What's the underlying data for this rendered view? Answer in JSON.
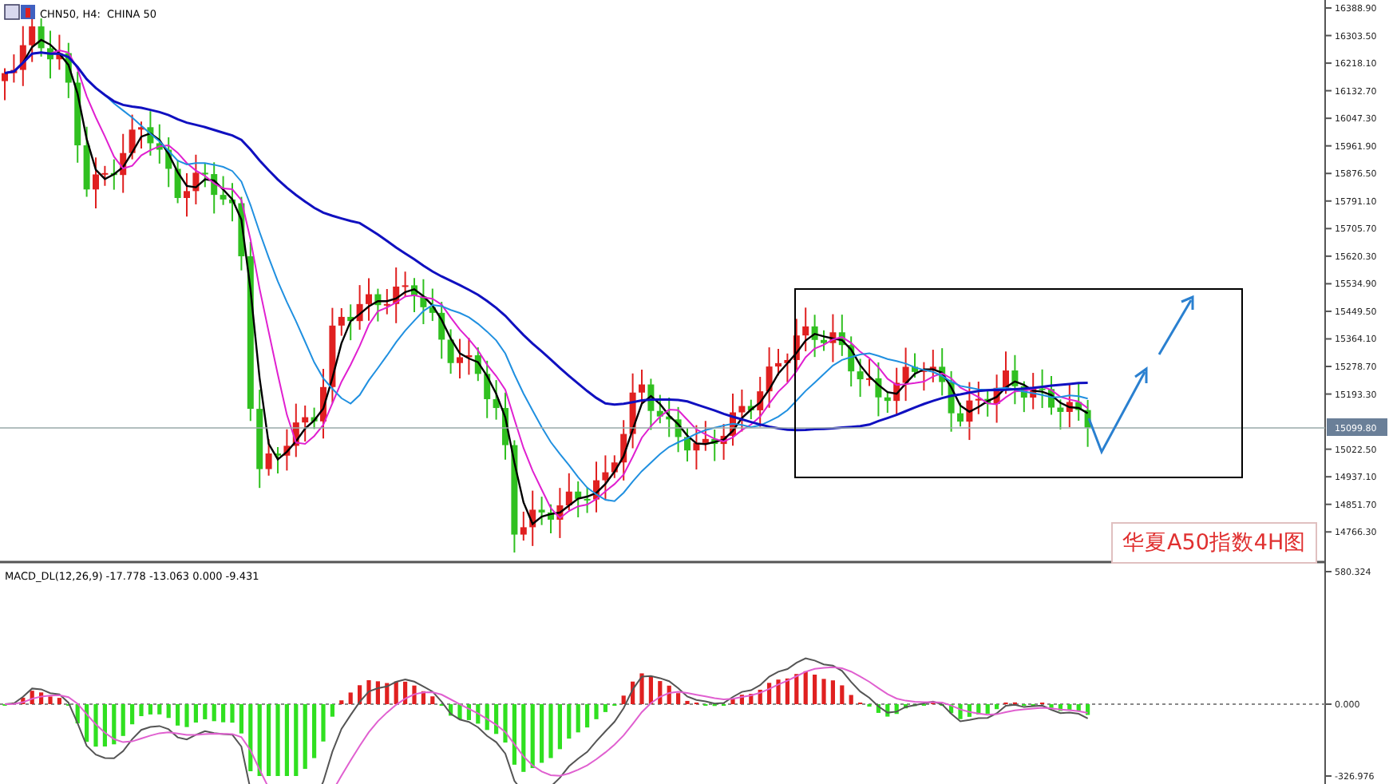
{
  "chart_header": {
    "symbol": "CHN50, H4:",
    "name": "CHINA 50"
  },
  "price_axis": {
    "ticks": [
      "16388.90",
      "16303.50",
      "16218.10",
      "16132.70",
      "16047.30",
      "15961.90",
      "15876.50",
      "15791.10",
      "15705.70",
      "15620.30",
      "15534.90",
      "15449.50",
      "15364.10",
      "15278.70",
      "15193.30",
      "15022.50",
      "14937.10",
      "14851.70",
      "14766.30"
    ],
    "current_price": "15099.80"
  },
  "annotation": {
    "text": "华夏A50指数4H图"
  },
  "indicator": {
    "label": "MACD_DL(12,26,9) -17.778 -13.063 0.000 -9.431",
    "axis_ticks": [
      "580.324",
      "0.000",
      "-326.976"
    ]
  }
}
